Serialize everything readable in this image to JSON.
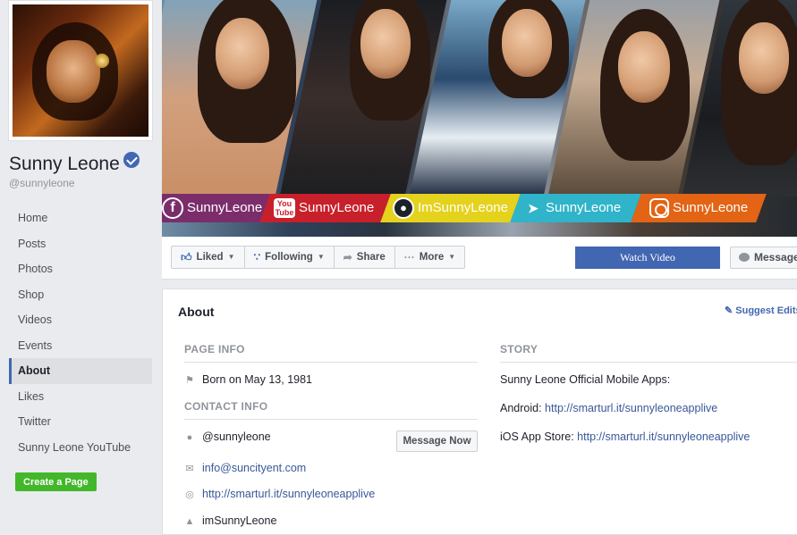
{
  "page": {
    "name": "Sunny Leone",
    "handle": "@sunnyleone",
    "brand_color": "#4267b2",
    "green": "#42b72a"
  },
  "nav": {
    "items": [
      "Home",
      "Posts",
      "Photos",
      "Shop",
      "Videos",
      "Events",
      "About",
      "Likes",
      "Twitter",
      "Sunny Leone YouTube"
    ],
    "active": "About"
  },
  "create_page_label": "Create a Page",
  "cover": {
    "social": [
      {
        "icon": "facebook-icon",
        "label": "SunnyLeone",
        "color": "#7b2d6b"
      },
      {
        "icon": "youtube-icon",
        "label": "SunnyLeone",
        "color": "#c8202b"
      },
      {
        "icon": "snapchat-icon",
        "label": "ImSunnyLeone",
        "color": "#e5d21c"
      },
      {
        "icon": "twitter-icon",
        "label": "SunnyLeone",
        "color": "#2fb4c9"
      },
      {
        "icon": "instagram-icon",
        "label": "SunnyLeone",
        "color": "#e26414"
      }
    ],
    "youtube_icon_text": [
      "You",
      "Tube"
    ]
  },
  "actions": {
    "liked": "Liked",
    "following": "Following",
    "share": "Share",
    "more": "More",
    "watch_video": "Watch Video",
    "message": "Message"
  },
  "about": {
    "title": "About",
    "suggest_edits": "Suggest Edits",
    "page_info_heading": "PAGE INFO",
    "born": "Born on May 13, 1981",
    "contact_heading": "CONTACT INFO",
    "messenger": "@sunnyleone",
    "message_now": "Message Now",
    "email": "info@suncityent.com",
    "website": "http://smarturl.it/sunnyleoneapplive",
    "snapchat": "imSunnyLeone",
    "story_heading": "STORY",
    "story_line1": "Sunny Leone Official Mobile Apps:",
    "android_label": "Android:",
    "android_link": "http://smarturl.it/sunnyleoneapplive",
    "ios_label": "iOS App Store:",
    "ios_link": "http://smarturl.it/sunnyleoneapplive"
  }
}
